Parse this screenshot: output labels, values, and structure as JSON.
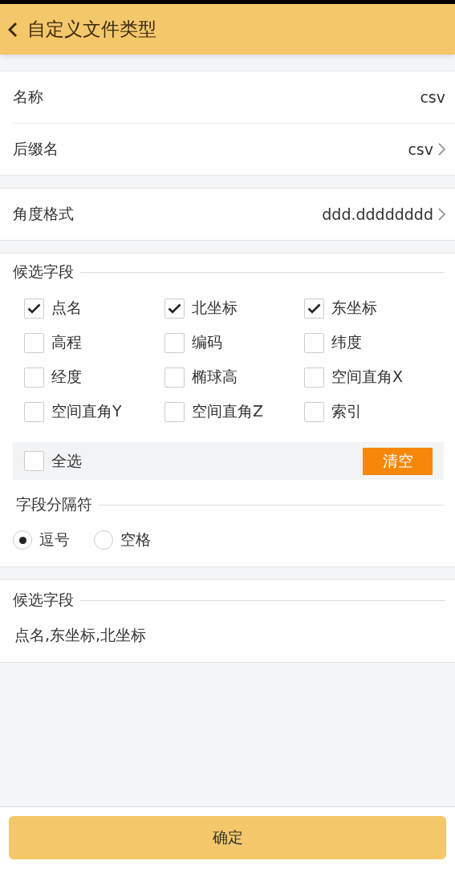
{
  "header": {
    "title": "自定义文件类型"
  },
  "settings": [
    {
      "label": "名称",
      "value": "csv",
      "kind": "text"
    },
    {
      "label": "后缀名",
      "value": "csv",
      "kind": "link"
    }
  ],
  "angle": {
    "label": "角度格式",
    "value": "ddd.dddddddd",
    "kind": "link"
  },
  "fields": {
    "title": "候选字段",
    "items": [
      {
        "label": "点名",
        "checked": true
      },
      {
        "label": "北坐标",
        "checked": true
      },
      {
        "label": "东坐标",
        "checked": true
      },
      {
        "label": "高程",
        "checked": false
      },
      {
        "label": "编码",
        "checked": false
      },
      {
        "label": "纬度",
        "checked": false
      },
      {
        "label": "经度",
        "checked": false
      },
      {
        "label": "椭球高",
        "checked": false
      },
      {
        "label": "空间直角X",
        "checked": false
      },
      {
        "label": "空间直角Y",
        "checked": false
      },
      {
        "label": "空间直角Z",
        "checked": false
      },
      {
        "label": "索引",
        "checked": false
      }
    ],
    "select_all": {
      "label": "全选",
      "checked": false
    },
    "clear_button": "清空"
  },
  "separator": {
    "title": "字段分隔符",
    "options": [
      {
        "label": "逗号",
        "selected": true
      },
      {
        "label": "空格",
        "selected": false
      }
    ]
  },
  "result": {
    "title": "候选字段",
    "text": "点名,东坐标,北坐标"
  },
  "confirm_button": "确定"
}
